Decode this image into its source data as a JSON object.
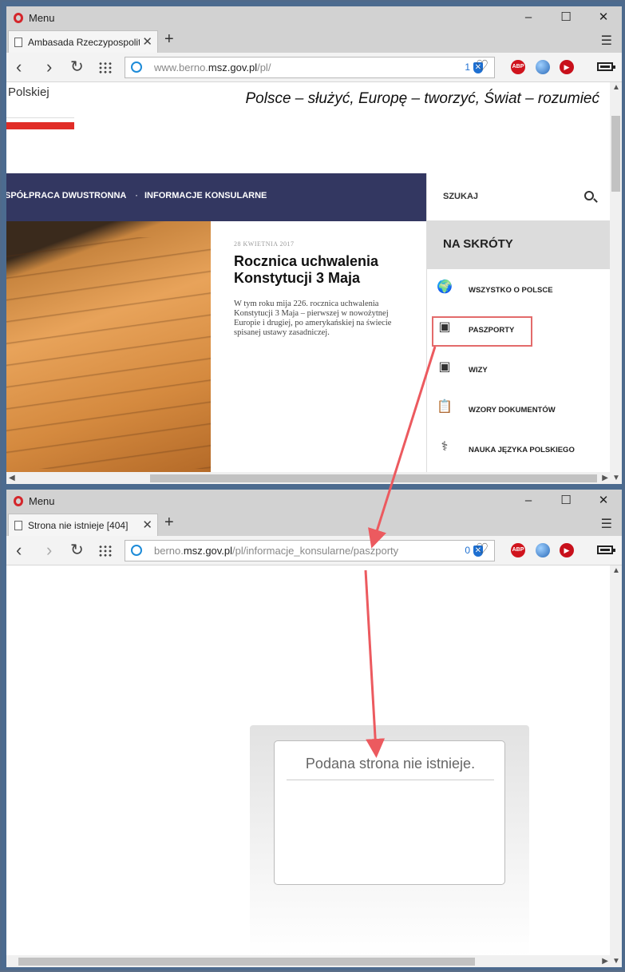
{
  "window1": {
    "menu_label": "Menu",
    "tab_title": "Ambasada Rzeczypospolit",
    "address": {
      "host_dim": "www.berno.",
      "host_strong": "msz.gov.pl",
      "path": "/pl/",
      "tracker_count": "1"
    },
    "page": {
      "brand_fragment": "Polskiej",
      "motto": "Polsce – służyć, Europę – tworzyć, Świat – rozumieć",
      "nav": {
        "item1": "SPÓŁPRACA DWUSTRONNA",
        "separator": "·",
        "item2": "INFORMACJE KONSULARNE"
      },
      "search_label": "SZUKAJ",
      "article": {
        "date": "28 KWIETNIA 2017",
        "title": "Rocznica uchwalenia Konstytucji 3 Maja",
        "excerpt": "W tym roku mija 226. rocznica uchwalenia Konstytucji 3 Maja – pierwszej w nowożytnej Europie i drugiej, po amerykańskiej na świecie spisanej ustawy zasadniczej."
      },
      "sidebar": {
        "title": "NA SKRÓTY",
        "items": [
          {
            "label": "WSZYSTKO O POLSCE",
            "icon": "globe-icon"
          },
          {
            "label": "PASZPORTY",
            "icon": "passport-icon"
          },
          {
            "label": "WIZY",
            "icon": "visa-icon"
          },
          {
            "label": "WZORY DOKUMENTÓW",
            "icon": "clipboard-icon"
          },
          {
            "label": "NAUKA JĘZYKA POLSKIEGO",
            "icon": "language-icon"
          }
        ]
      }
    }
  },
  "window2": {
    "menu_label": "Menu",
    "tab_title": "Strona nie istnieje [404]",
    "address": {
      "host_dim": "berno.",
      "host_strong": "msz.gov.pl",
      "path": "/pl/informacje_konsularne/paszporty",
      "tracker_count": "0"
    },
    "page": {
      "error_message": "Podana strona nie istnieje."
    }
  },
  "colors": {
    "annotation": "#ec5a5f",
    "nav_bg": "#333761",
    "flag_red": "#e12d27"
  }
}
